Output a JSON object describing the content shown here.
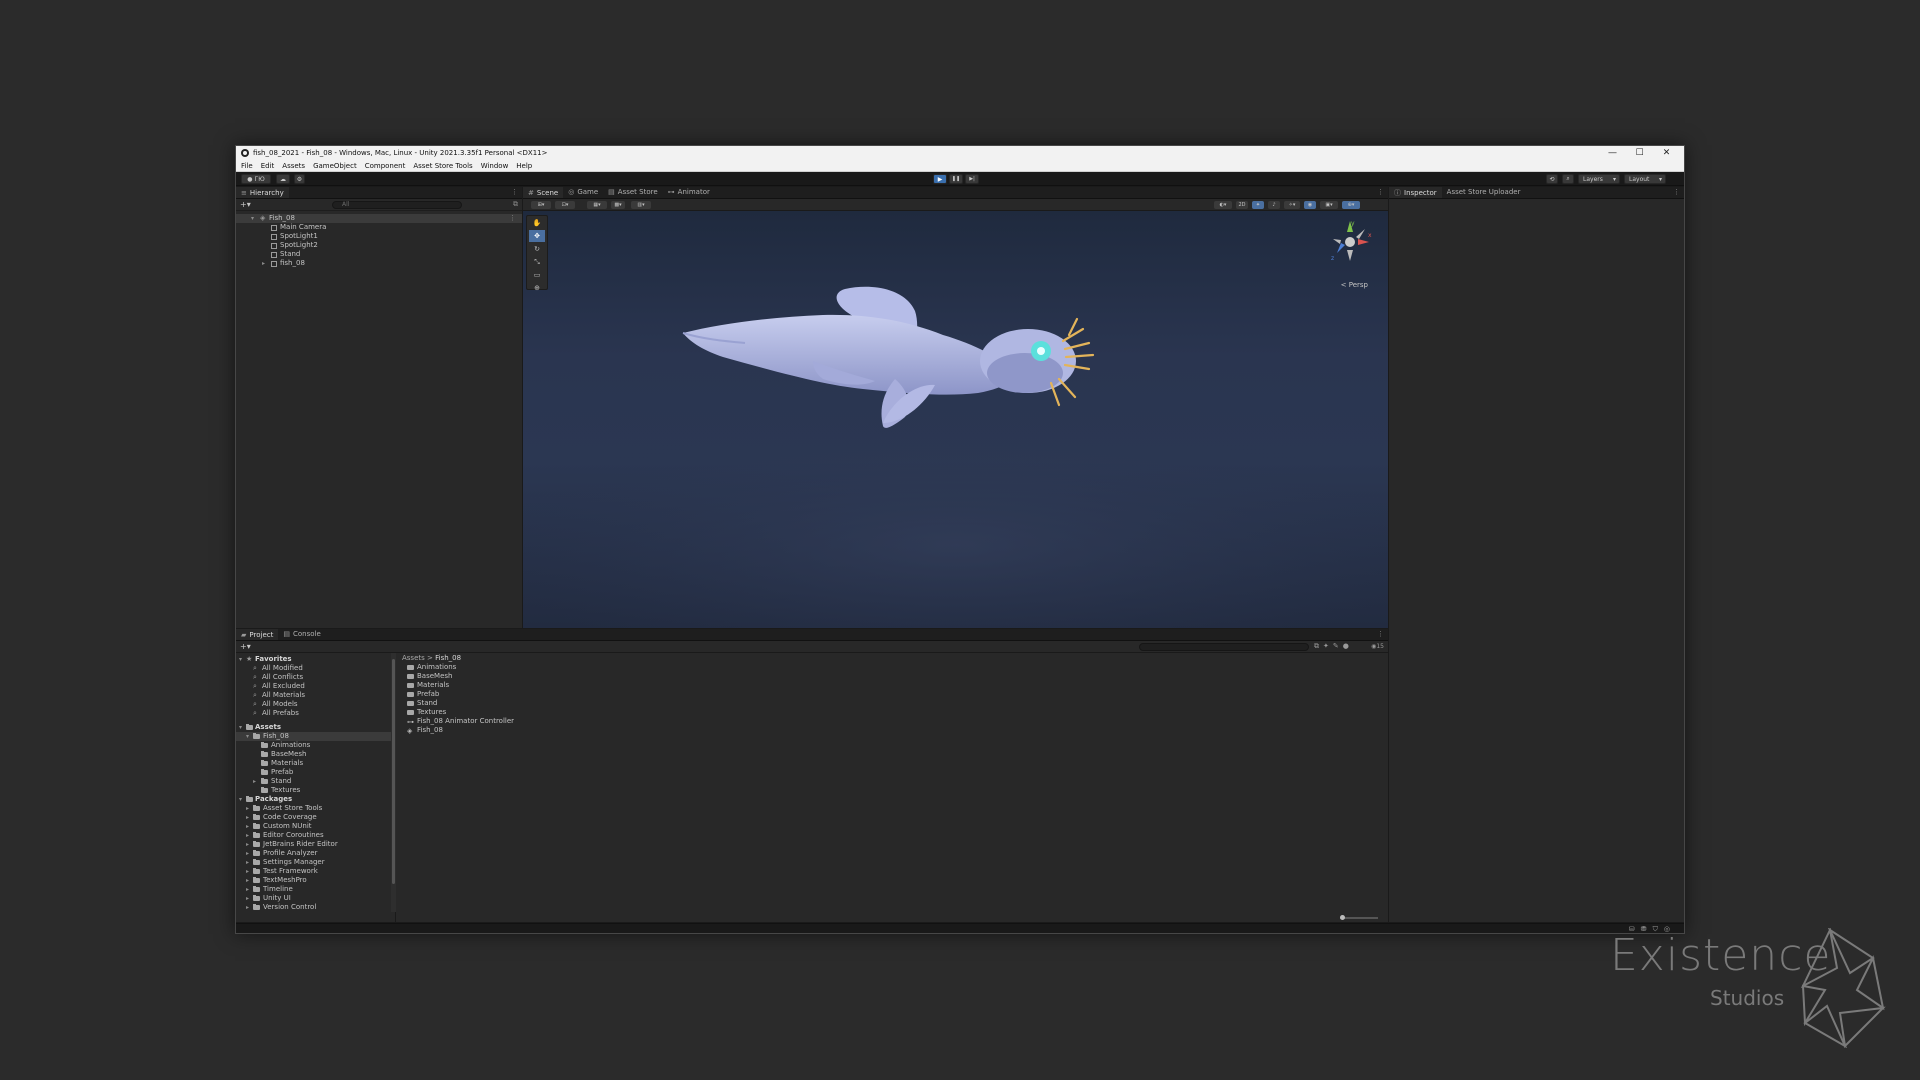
{
  "window": {
    "title": "fish_08_2021 - Fish_08 - Windows, Mac, Linux - Unity 2021.3.35f1 Personal <DX11>",
    "controls": [
      "—",
      "☐",
      "✕"
    ]
  },
  "menu": [
    "File",
    "Edit",
    "Assets",
    "GameObject",
    "Component",
    "Asset Store Tools",
    "Window",
    "Help"
  ],
  "toolbar": {
    "account_label": "ГЮ",
    "layers_label": "Layers",
    "layout_label": "Layout",
    "play_icon": "▶",
    "pause_icon": "❚❚",
    "step_icon": "▶|"
  },
  "hierarchy": {
    "tab": "Hierarchy",
    "search_placeholder": "All",
    "root": "Fish_08",
    "children": [
      "Main Camera",
      "SpotLight1",
      "SpotLight2",
      "Stand",
      "fish_08"
    ]
  },
  "scene": {
    "tabs": [
      "Scene",
      "Game",
      "Asset Store",
      "Animator"
    ],
    "gizmo_label": "< Persp",
    "gizmo_axes": [
      "y",
      "x",
      "z"
    ]
  },
  "inspector": {
    "tabs": [
      "Inspector",
      "Asset Store Uploader"
    ]
  },
  "project": {
    "tabs": [
      "Project",
      "Console"
    ],
    "search_count": "15",
    "favorites_title": "Favorites",
    "favorites": [
      "All Modified",
      "All Conflicts",
      "All Excluded",
      "All Materials",
      "All Models",
      "All Prefabs"
    ],
    "assets_title": "Assets",
    "selected_folder": "Fish_08",
    "fish_children": [
      "Animations",
      "BaseMesh",
      "Materials",
      "Prefab",
      "Stand",
      "Textures"
    ],
    "packages_title": "Packages",
    "packages": [
      "Asset Store Tools",
      "Code Coverage",
      "Custom NUnit",
      "Editor Coroutines",
      "JetBrains Rider Editor",
      "Profile Analyzer",
      "Settings Manager",
      "Test Framework",
      "TextMeshPro",
      "Timeline",
      "Unity UI",
      "Version Control"
    ],
    "breadcrumb": [
      "Assets",
      ">",
      "Fish_08"
    ],
    "files": [
      "Animations",
      "BaseMesh",
      "Materials",
      "Prefab",
      "Stand",
      "Textures",
      "Fish_08 Animator Controller",
      "Fish_08"
    ]
  },
  "watermark": {
    "name": "Existence",
    "sub": "Studios"
  }
}
